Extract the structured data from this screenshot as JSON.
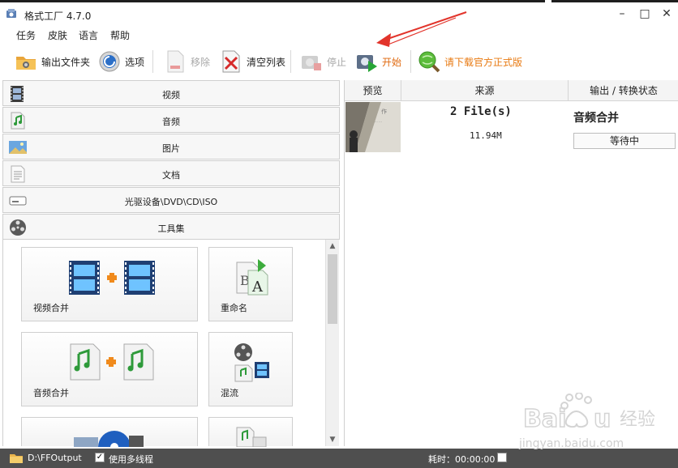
{
  "window": {
    "title": "格式工厂 4.7.0",
    "controls": {
      "minimize": "–",
      "maximize": "□",
      "close": "✕"
    }
  },
  "menu": [
    {
      "label": "任务"
    },
    {
      "label": "皮肤"
    },
    {
      "label": "语言"
    },
    {
      "label": "帮助"
    }
  ],
  "toolbar": {
    "output_folder": "输出文件夹",
    "options": "选项",
    "remove": "移除",
    "clear_list": "清空列表",
    "stop": "停止",
    "start": "开始",
    "download_official": "请下载官方正式版"
  },
  "categories": [
    {
      "label": "视频",
      "icon": "film-icon"
    },
    {
      "label": "音频",
      "icon": "music-note-icon"
    },
    {
      "label": "图片",
      "icon": "picture-icon"
    },
    {
      "label": "文档",
      "icon": "document-icon"
    },
    {
      "label": "光驱设备\\DVD\\CD\\ISO",
      "icon": "optical-drive-icon"
    },
    {
      "label": "工具集",
      "icon": "film-reel-icon"
    }
  ],
  "tools": [
    {
      "label": "视频合并",
      "icon": "video-merge-icon"
    },
    {
      "label": "重命名",
      "icon": "rename-icon"
    },
    {
      "label": "音频合并",
      "icon": "audio-merge-icon"
    },
    {
      "label": "混流",
      "icon": "mux-icon"
    }
  ],
  "task_table": {
    "headers": [
      "预览",
      "来源",
      "输出 / 转换状态"
    ],
    "rows": [
      {
        "source_files": "2 File(s)",
        "source_size": "11.94M",
        "output": "音频合并",
        "status": "等待中"
      }
    ]
  },
  "statusbar": {
    "output_path": "D:\\FFOutput",
    "multithread_label": "使用多线程",
    "multithread_checked": "✓",
    "elapsed": "耗时：00:00:00"
  },
  "watermark": {
    "text": "jingyan.baidu.com"
  },
  "colors": {
    "accent_orange": "#f07b1a",
    "download_text": "#e87a12",
    "statusbar_bg": "#4f4f4f",
    "annotation_red": "#e2342b"
  }
}
